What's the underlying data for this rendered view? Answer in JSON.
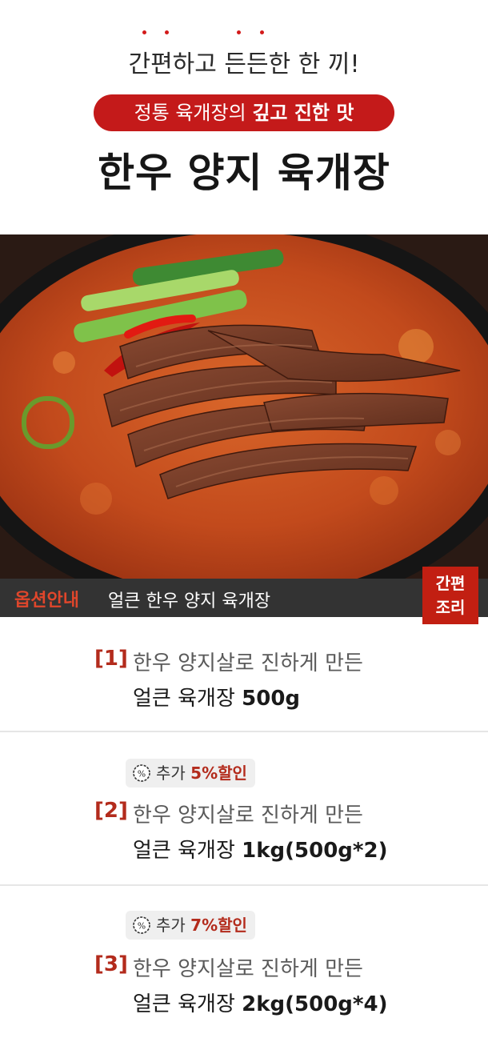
{
  "header": {
    "tagline": "간편하고 든든한 한 끼!",
    "pill_prefix": "정통 육개장의 ",
    "pill_emphasis": "깊고 진한 맛",
    "title": "한우 양지 육개장"
  },
  "option_bar": {
    "label": "옵션안내",
    "text": "얼큰 한우 양지 육개장",
    "badge_line1": "간편",
    "badge_line2": "조리"
  },
  "options": [
    {
      "number": "[1]",
      "line1": "한우 양지살로 진하게 만든",
      "line2_prefix": "얼큰 육개장 ",
      "line2_bold": "500g"
    },
    {
      "discount_prefix": "추가 ",
      "discount_value": "5%할인",
      "number": "[2]",
      "line1": "한우 양지살로 진하게 만든",
      "line2_prefix": "얼큰 육개장 ",
      "line2_bold": "1kg(500g*2)"
    },
    {
      "discount_prefix": "추가 ",
      "discount_value": "7%할인",
      "number": "[3]",
      "line1": "한우 양지살로 진하게 만든",
      "line2_prefix": "얼큰 육개장 ",
      "line2_bold": "2kg(500g*4)"
    }
  ],
  "colors": {
    "accent_red": "#c41a1a",
    "option_number": "#b32b1c",
    "option_bar_bg": "#333333"
  }
}
